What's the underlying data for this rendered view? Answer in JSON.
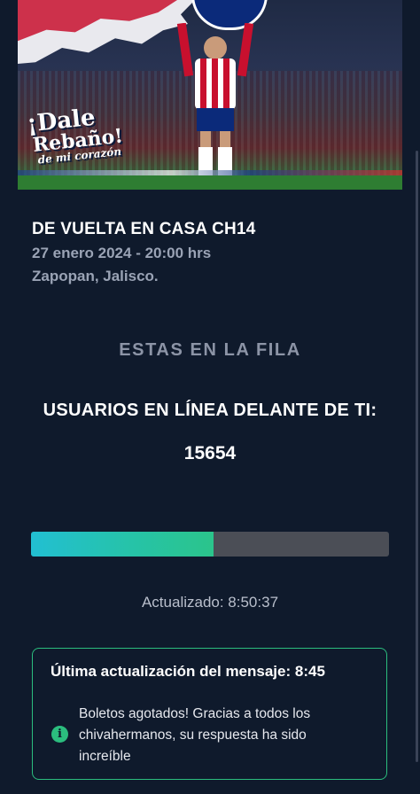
{
  "banner": {
    "tagline_line1": "¡Dale",
    "tagline_line2": "Rebaño!",
    "tagline_line3": "de mi corazón"
  },
  "event": {
    "title": "DE VUELTA EN CASA CH14",
    "datetime": "27 enero 2024 - 20:00 hrs",
    "location": "Zapopan, Jalisco."
  },
  "queue": {
    "status": "ESTAS EN LA FILA",
    "ahead_label": "USUARIOS EN LÍNEA DELANTE DE TI:",
    "ahead_count": "15654",
    "progress_fraction": 0.51,
    "updated_text": "Actualizado: 8:50:37"
  },
  "message": {
    "heading": "Última actualización del mensaje: 8:45",
    "body": "Boletos agotados! Gracias a todos los chivahermanos, su respuesta ha sido increíble",
    "icon": "info-icon"
  },
  "colors": {
    "background": "#0f1a2c",
    "accent_green": "#2bbd7e",
    "progress_cyan": "#22bfd2",
    "track_gray": "#4b4e56"
  }
}
